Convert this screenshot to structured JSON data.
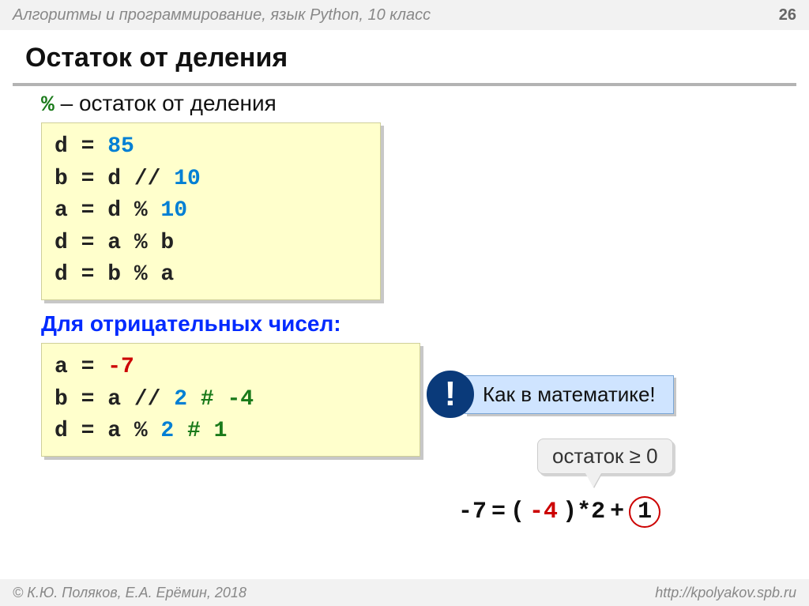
{
  "header": {
    "course": "Алгоритмы и программирование, язык Python, 10 класс",
    "page_number": "26"
  },
  "title": "Остаток от деления",
  "lead": {
    "symbol": "%",
    "text": "– остаток от деления"
  },
  "code1": {
    "l1_lhs": "d = ",
    "l1_num": "85",
    "l2_lhs": "b = d // ",
    "l2_num": "10",
    "l3_lhs": "a = d % ",
    "l3_num": "10",
    "l4": "d = a % b",
    "l5": "d = b % a"
  },
  "subhead": "Для отрицательных чисел:",
  "code2": {
    "l1_lhs": "a = ",
    "l1_neg": "-7",
    "l2_lhs": "b = a // ",
    "l2_num": "2",
    "l2_cmt": "  # -4",
    "l3_lhs": "d = a % ",
    "l3_num": "2",
    "l3_cmt": "  # 1"
  },
  "note": {
    "bang": "!",
    "label": "Как в математике!"
  },
  "callout": "остаток ≥ 0",
  "equation": {
    "lhs": "-7",
    "eq": " = ",
    "paren_open": "(",
    "neg4": "-4",
    "paren_close_mul": ")*2",
    "plus": " + ",
    "one": "1"
  },
  "footer": {
    "authors": "© К.Ю. Поляков, Е.А. Ерёмин, 2018",
    "url": "http://kpolyakov.spb.ru"
  }
}
